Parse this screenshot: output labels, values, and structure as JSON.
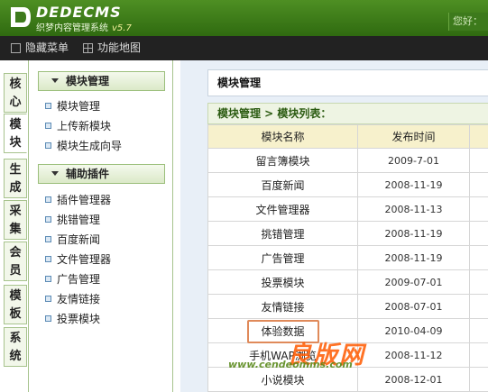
{
  "header": {
    "brand": "DEDECMS",
    "subtitle": "织梦内容管理系统",
    "version": "v5.7",
    "greeting": "您好："
  },
  "toolbar": {
    "hide_menu": "隐藏菜单",
    "function_map": "功能地图"
  },
  "side_tabs": [
    {
      "label": "核心",
      "active": false
    },
    {
      "label": "模块",
      "active": true
    },
    {
      "label": "生成",
      "active": false
    },
    {
      "label": "采集",
      "active": false
    },
    {
      "label": "会员",
      "active": false
    },
    {
      "label": "模板",
      "active": false
    },
    {
      "label": "系统",
      "active": false
    }
  ],
  "menu": {
    "group1": {
      "title": "模块管理",
      "items": [
        "模块管理",
        "上传新模块",
        "模块生成向导"
      ]
    },
    "group2": {
      "title": "辅助插件",
      "items": [
        "插件管理器",
        "挑错管理",
        "百度新闻",
        "文件管理器",
        "广告管理",
        "友情链接",
        "投票模块"
      ]
    }
  },
  "main": {
    "title": "模块管理",
    "breadcrumb": "模块管理 > 模块列表：",
    "columns": [
      "模块名称",
      "发布时间",
      ""
    ],
    "rows": [
      {
        "name": "留言簿模块",
        "date": "2009-7-01"
      },
      {
        "name": "百度新闻",
        "date": "2008-11-19"
      },
      {
        "name": "文件管理器",
        "date": "2008-11-13"
      },
      {
        "name": "挑错管理",
        "date": "2008-11-19"
      },
      {
        "name": "广告管理",
        "date": "2008-11-19"
      },
      {
        "name": "投票模块",
        "date": "2009-07-01"
      },
      {
        "name": "友情链接",
        "date": "2008-07-01"
      },
      {
        "name": "体验数据",
        "date": "2010-04-09"
      },
      {
        "name": "手机WAP浏览",
        "date": "2008-11-12"
      },
      {
        "name": "小说模块",
        "date": "2008-12-01"
      }
    ]
  },
  "watermark": {
    "line1": "良版网",
    "line2": "www.cendeomms.com"
  },
  "colors": {
    "header_green": "#3d7a1c",
    "toolbar_dark": "#222222",
    "table_header": "#f7f1cc",
    "highlight_border": "#e08a5a"
  }
}
